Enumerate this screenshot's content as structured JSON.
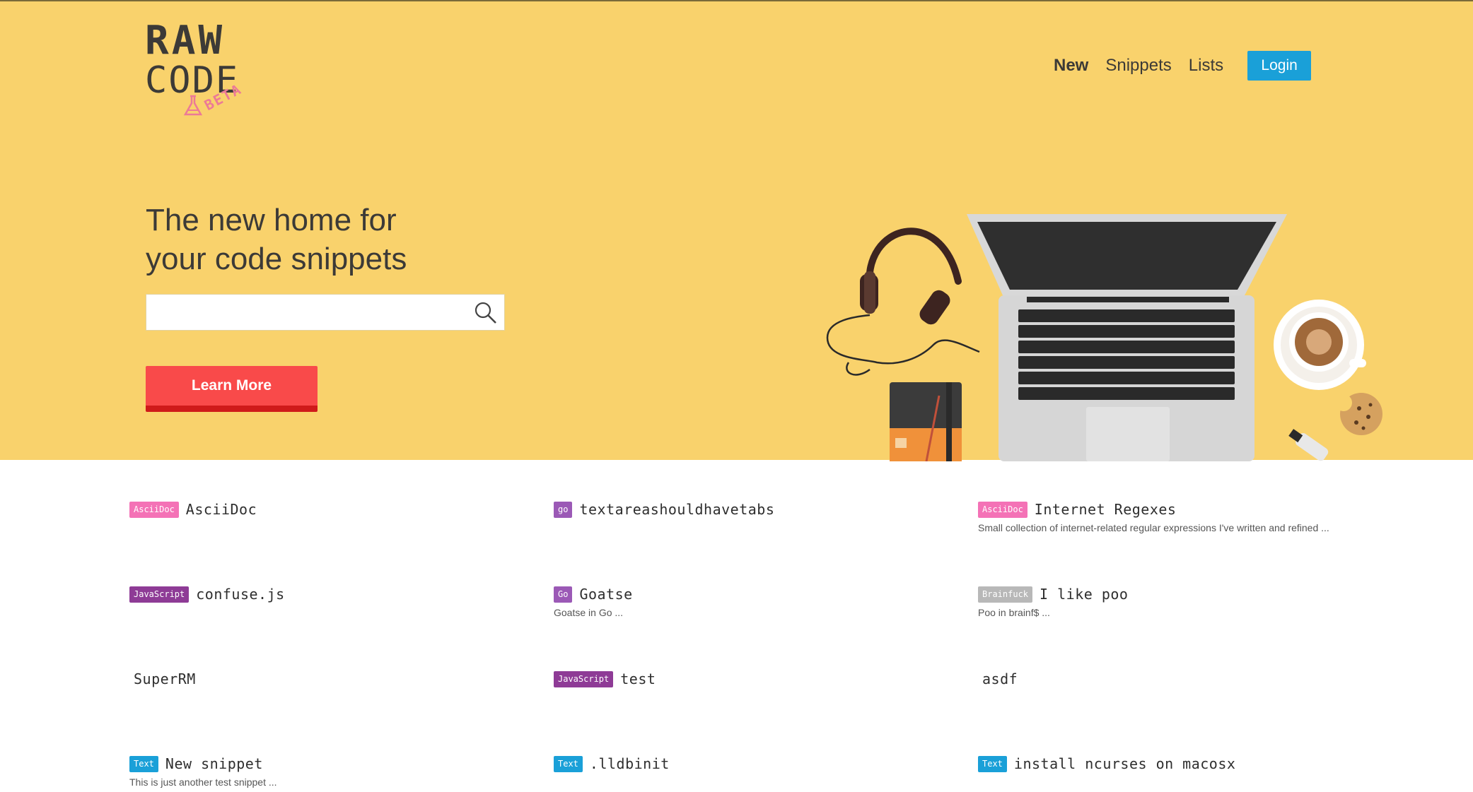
{
  "logo": {
    "line1": "RAW",
    "line2": "CODE",
    "badge": "BETA"
  },
  "nav": {
    "items": [
      {
        "label": "New",
        "active": true
      },
      {
        "label": "Snippets",
        "active": false
      },
      {
        "label": "Lists",
        "active": false
      }
    ],
    "login_label": "Login"
  },
  "hero": {
    "headline_line1": "The new home for",
    "headline_line2": "your code snippets",
    "search_placeholder": "",
    "search_value": "",
    "learn_more_label": "Learn More"
  },
  "colors": {
    "hero_bg": "#f9d26c",
    "login": "#1aa0d8",
    "learn_more": "#f94a4a",
    "asciidoc": "#f472b6",
    "go": "#9b59b6",
    "javascript": "#8e3b96",
    "brainfuck": "#b8b8b8",
    "text": "#1aa0d8"
  },
  "snippets": [
    {
      "tag": "AsciiDoc",
      "tag_color": "#f472b6",
      "title": "AsciiDoc",
      "desc": ""
    },
    {
      "tag": "go",
      "tag_color": "#9b59b6",
      "title": "textareashouldhavetabs",
      "desc": ""
    },
    {
      "tag": "AsciiDoc",
      "tag_color": "#f472b6",
      "title": "Internet Regexes",
      "desc": "Small collection of internet-related regular expressions I've written and refined ..."
    },
    {
      "tag": "JavaScript",
      "tag_color": "#8e3b96",
      "title": "confuse.js",
      "desc": ""
    },
    {
      "tag": "Go",
      "tag_color": "#9b59b6",
      "title": "Goatse",
      "desc": "Goatse in Go ..."
    },
    {
      "tag": "Brainfuck",
      "tag_color": "#b8b8b8",
      "title": "I like poo",
      "desc": "Poo in brainf$ ..."
    },
    {
      "tag": "",
      "tag_color": "",
      "title": "SuperRM",
      "desc": ""
    },
    {
      "tag": "JavaScript",
      "tag_color": "#8e3b96",
      "title": "test",
      "desc": ""
    },
    {
      "tag": "",
      "tag_color": "",
      "title": "asdf",
      "desc": ""
    },
    {
      "tag": "Text",
      "tag_color": "#1aa0d8",
      "title": "New snippet",
      "desc": "This is just another test snippet ..."
    },
    {
      "tag": "Text",
      "tag_color": "#1aa0d8",
      "title": ".lldbinit",
      "desc": ""
    },
    {
      "tag": "Text",
      "tag_color": "#1aa0d8",
      "title": "install ncurses on macosx",
      "desc": ""
    }
  ]
}
